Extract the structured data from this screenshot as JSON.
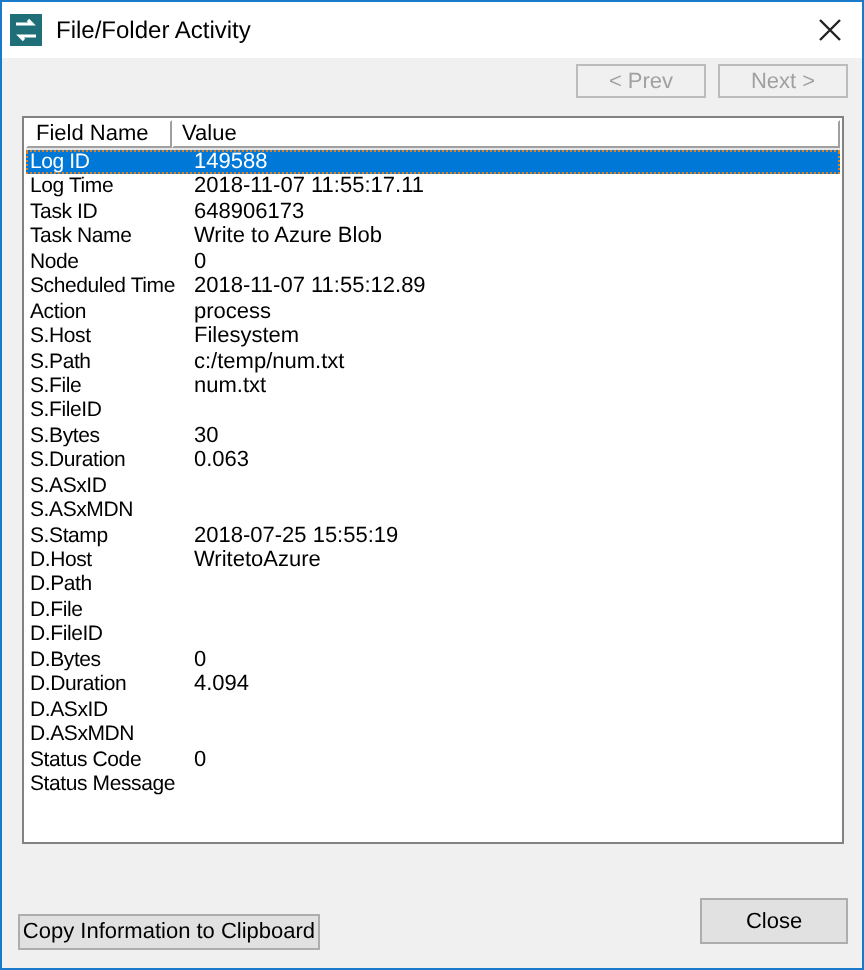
{
  "window": {
    "title": "File/Folder Activity"
  },
  "nav_buttons": [
    {
      "label": "< Prev",
      "disabled": true
    },
    {
      "label": "Next >",
      "disabled": true
    }
  ],
  "table": {
    "columns": [
      "Field Name",
      "Value"
    ],
    "rows": [
      {
        "field": "Log ID",
        "value": "149588",
        "selected": true
      },
      {
        "field": "Log Time",
        "value": "2018-11-07 11:55:17.11",
        "selected": false
      },
      {
        "field": "Task ID",
        "value": "648906173",
        "selected": false
      },
      {
        "field": "Task Name",
        "value": "Write to Azure Blob",
        "selected": false
      },
      {
        "field": "Node",
        "value": "0",
        "selected": false
      },
      {
        "field": "Scheduled Time",
        "value": "2018-11-07 11:55:12.89",
        "selected": false
      },
      {
        "field": "Action",
        "value": "process",
        "selected": false
      },
      {
        "field": "S.Host",
        "value": "Filesystem",
        "selected": false
      },
      {
        "field": "S.Path",
        "value": "c:/temp/num.txt",
        "selected": false
      },
      {
        "field": "S.File",
        "value": "num.txt",
        "selected": false
      },
      {
        "field": "S.FileID",
        "selected": false
      },
      {
        "field": "S.Bytes",
        "value": "30",
        "selected": false
      },
      {
        "field": "S.Duration",
        "value": "0.063",
        "selected": false
      },
      {
        "field": "S.ASxID",
        "selected": false
      },
      {
        "field": "S.ASxMDN",
        "selected": false
      },
      {
        "field": "S.Stamp",
        "value": "2018-07-25 15:55:19",
        "selected": false
      },
      {
        "field": "D.Host",
        "value": "WritetoAzure",
        "selected": false
      },
      {
        "field": "D.Path",
        "selected": false
      },
      {
        "field": "D.File",
        "selected": false
      },
      {
        "field": "D.FileID",
        "selected": false
      },
      {
        "field": "D.Bytes",
        "value": "0",
        "selected": false
      },
      {
        "field": "D.Duration",
        "value": "4.094",
        "selected": false
      },
      {
        "field": "D.ASxID",
        "selected": false
      },
      {
        "field": "D.ASxMDN",
        "selected": false
      },
      {
        "field": "Status Code",
        "value": "0",
        "selected": false
      },
      {
        "field": "Status Message",
        "selected": false
      }
    ]
  },
  "footer_buttons": {
    "copy": "Copy Information to Clipboard",
    "close": "Close"
  }
}
